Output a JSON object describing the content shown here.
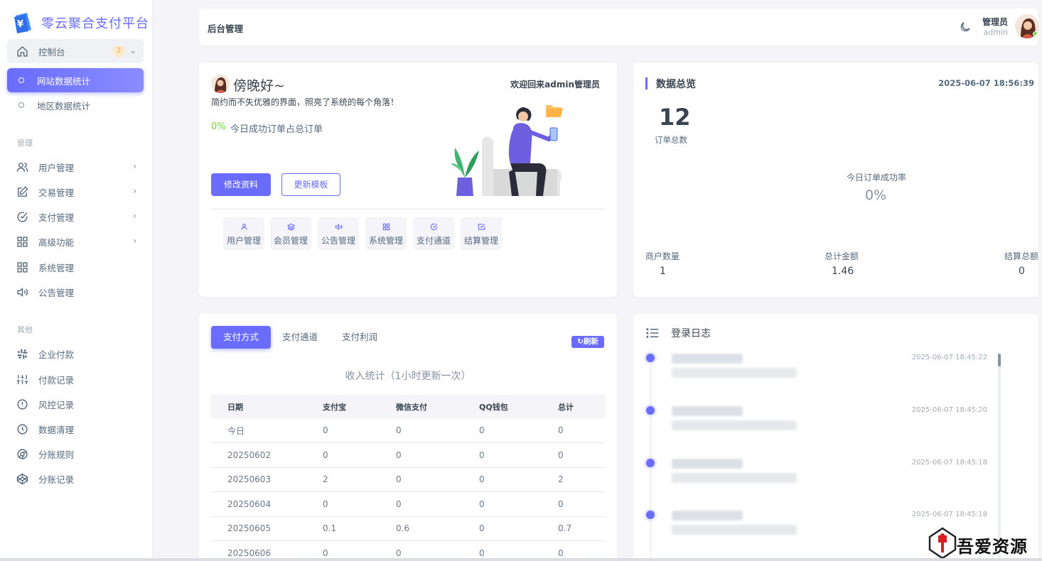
{
  "brand": {
    "name": "零云聚合支付平台"
  },
  "sidebar": {
    "dashboard": {
      "label": "控制台",
      "badge": "2"
    },
    "sub_items": [
      {
        "label": "网站数据统计",
        "active": true
      },
      {
        "label": "地区数据统计",
        "active": false
      }
    ],
    "section_manage": "管理",
    "manage_items": [
      {
        "label": "用户管理",
        "icon": "users-icon"
      },
      {
        "label": "交易管理",
        "icon": "edit-icon"
      },
      {
        "label": "支付管理",
        "icon": "check-circle-icon"
      },
      {
        "label": "高级功能",
        "icon": "grid-icon"
      },
      {
        "label": "系统管理",
        "icon": "grid-icon"
      },
      {
        "label": "公告管理",
        "icon": "speaker-icon"
      }
    ],
    "section_other": "其他",
    "other_items": [
      {
        "label": "企业付款",
        "icon": "slack-icon"
      },
      {
        "label": "付款记录",
        "icon": "sliders-icon"
      },
      {
        "label": "风控记录",
        "icon": "alert-icon"
      },
      {
        "label": "数据清理",
        "icon": "clock-icon"
      },
      {
        "label": "分账规则",
        "icon": "chrome-icon"
      },
      {
        "label": "分账记录",
        "icon": "codepen-icon"
      }
    ]
  },
  "topbar": {
    "title": "后台管理",
    "user_name": "管理员",
    "user_role": "admin"
  },
  "welcome": {
    "greeting": "傍晚好~",
    "welcome_text": "欢迎回来admin管理员",
    "subtitle": "简约而不失优雅的界面，照亮了系统的每个角落！",
    "percent": "0%",
    "percent_label": "今日成功订单占总订单",
    "edit_button": "修改资料",
    "template_button": "更新模板",
    "quick_links": [
      {
        "label": "用户管理",
        "icon": "user-icon"
      },
      {
        "label": "会员管理",
        "icon": "layers-icon"
      },
      {
        "label": "公告管理",
        "icon": "speaker-icon"
      },
      {
        "label": "系统管理",
        "icon": "grid-icon"
      },
      {
        "label": "支付通道",
        "icon": "check-circle-icon"
      },
      {
        "label": "结算管理",
        "icon": "check-square-icon"
      }
    ]
  },
  "overview": {
    "title": "数据总览",
    "timestamp": "2025-06-07 18:56:39",
    "order_total": "12",
    "order_total_label": "订单总数",
    "success_rate_label": "今日订单成功率",
    "success_rate": "0%",
    "stats": [
      {
        "label": "商户数量",
        "value": "1"
      },
      {
        "label": "总计金额",
        "value": "1.46"
      },
      {
        "label": "结算总额",
        "value": "0"
      }
    ]
  },
  "income": {
    "tabs": [
      "支付方式",
      "支付通道",
      "支付利润"
    ],
    "refresh": "刷新",
    "title": "收入统计（1小时更新一次）",
    "columns": [
      "日期",
      "支付宝",
      "微信支付",
      "QQ钱包",
      "总计"
    ],
    "rows": [
      [
        "今日",
        "0",
        "0",
        "0",
        "0"
      ],
      [
        "20250602",
        "0",
        "0",
        "0",
        "0"
      ],
      [
        "20250603",
        "2",
        "0",
        "0",
        "2"
      ],
      [
        "20250604",
        "0",
        "0",
        "0",
        "0"
      ],
      [
        "20250605",
        "0.1",
        "0.6",
        "0",
        "0.7"
      ],
      [
        "20250606",
        "0",
        "0",
        "0",
        "0"
      ]
    ]
  },
  "login_log": {
    "title": "登录日志",
    "entries": [
      {
        "time": "2025-06-07 18:45:22"
      },
      {
        "time": "2025-06-07 18:45:20"
      },
      {
        "time": "2025-06-07 18:45:18"
      },
      {
        "time": "2025-06-07 18:45:18"
      }
    ]
  },
  "watermark": {
    "text": "吾爱资源网"
  },
  "colors": {
    "primary": "#696cff",
    "success": "#71dd37",
    "warning": "#ff9f43"
  }
}
